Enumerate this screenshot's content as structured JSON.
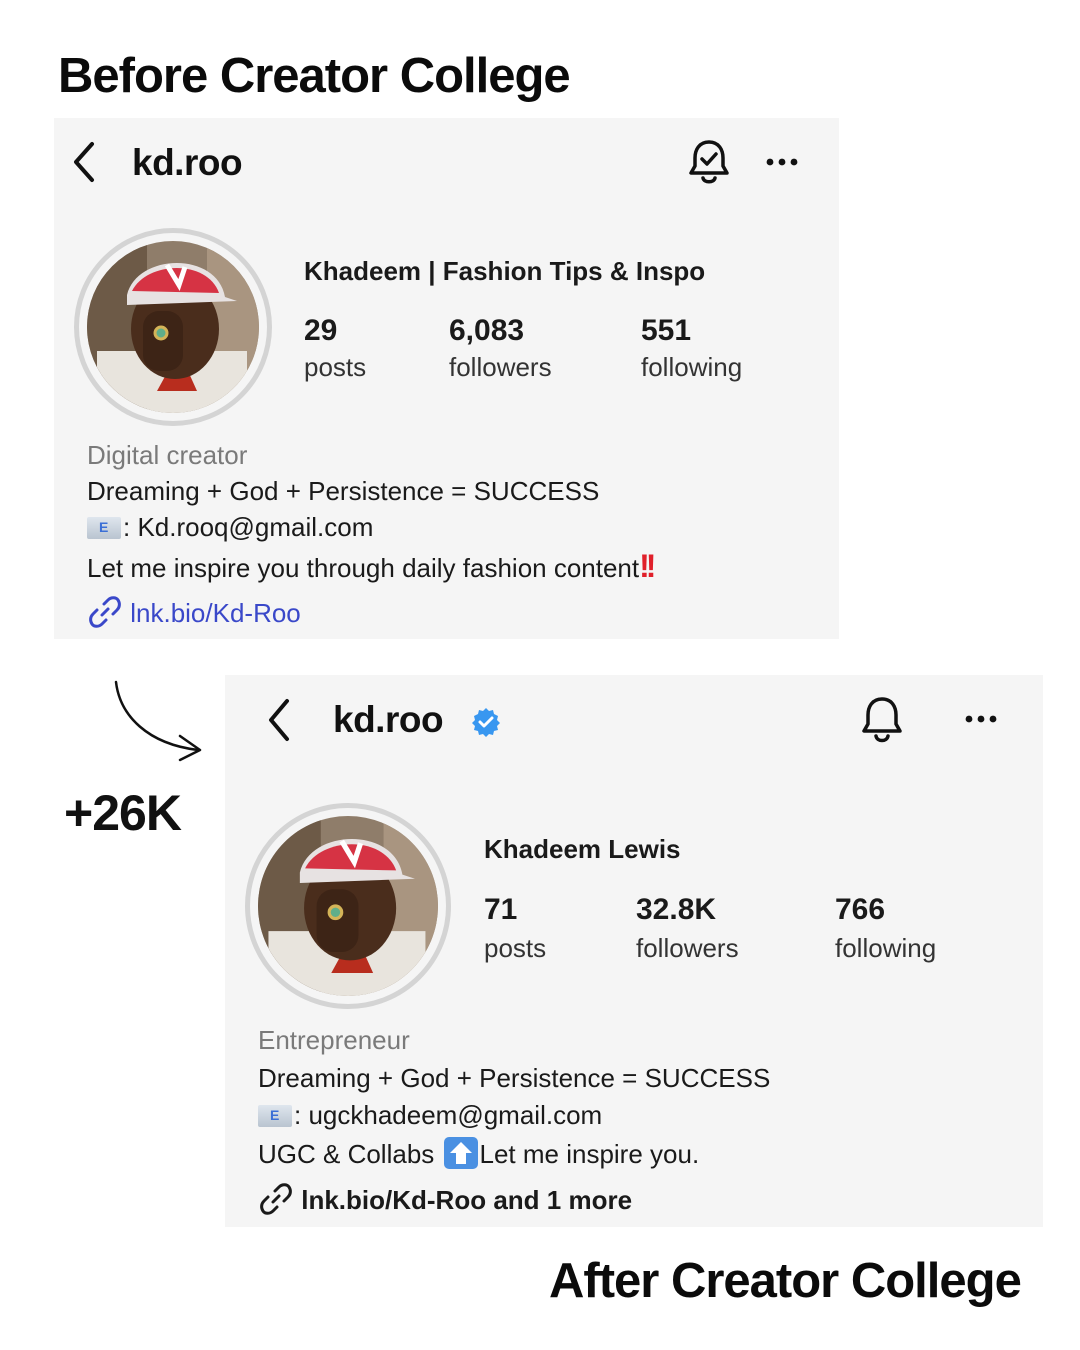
{
  "before": {
    "heading": "Before Creator College",
    "username": "kd.roo",
    "display_name": "Khadeem | Fashion Tips & Inspo",
    "stats": [
      {
        "value": "29",
        "label": "posts"
      },
      {
        "value": "6,083",
        "label": "followers"
      },
      {
        "value": "551",
        "label": "following"
      }
    ],
    "category": "Digital creator",
    "bio_line1": "Dreaming + God + Persistence = SUCCESS",
    "email": ": Kd.rooq@gmail.com",
    "bio_line3": "Let me inspire you through daily fashion content",
    "bio_line3_emoji": "!!",
    "link": "lnk.bio/Kd-Roo",
    "header_icons": [
      "back-chevron-icon",
      "bell-check-icon",
      "more-dots-icon"
    ]
  },
  "delta": "+26K",
  "after": {
    "heading": "After Creator College",
    "username": "kd.roo",
    "verified": true,
    "display_name": "Khadeem Lewis",
    "stats": [
      {
        "value": "71",
        "label": "posts"
      },
      {
        "value": "32.8K",
        "label": "followers"
      },
      {
        "value": "766",
        "label": "following"
      }
    ],
    "category": "Entrepreneur",
    "bio_line1": "Dreaming + God + Persistence = SUCCESS",
    "email": ": ugckhadeem@gmail.com",
    "bio_line3_a": "UGC & Collabs ",
    "bio_line3_b": "Let me inspire you.",
    "link": "lnk.bio/Kd-Roo and 1 more",
    "header_icons": [
      "back-chevron-icon",
      "bell-icon",
      "more-dots-icon"
    ]
  },
  "colors": {
    "card_bg": "#f5f5f5",
    "link_blue": "#3a48c9",
    "verified_blue": "#3897f0",
    "muted_text": "#7a7a7a"
  }
}
